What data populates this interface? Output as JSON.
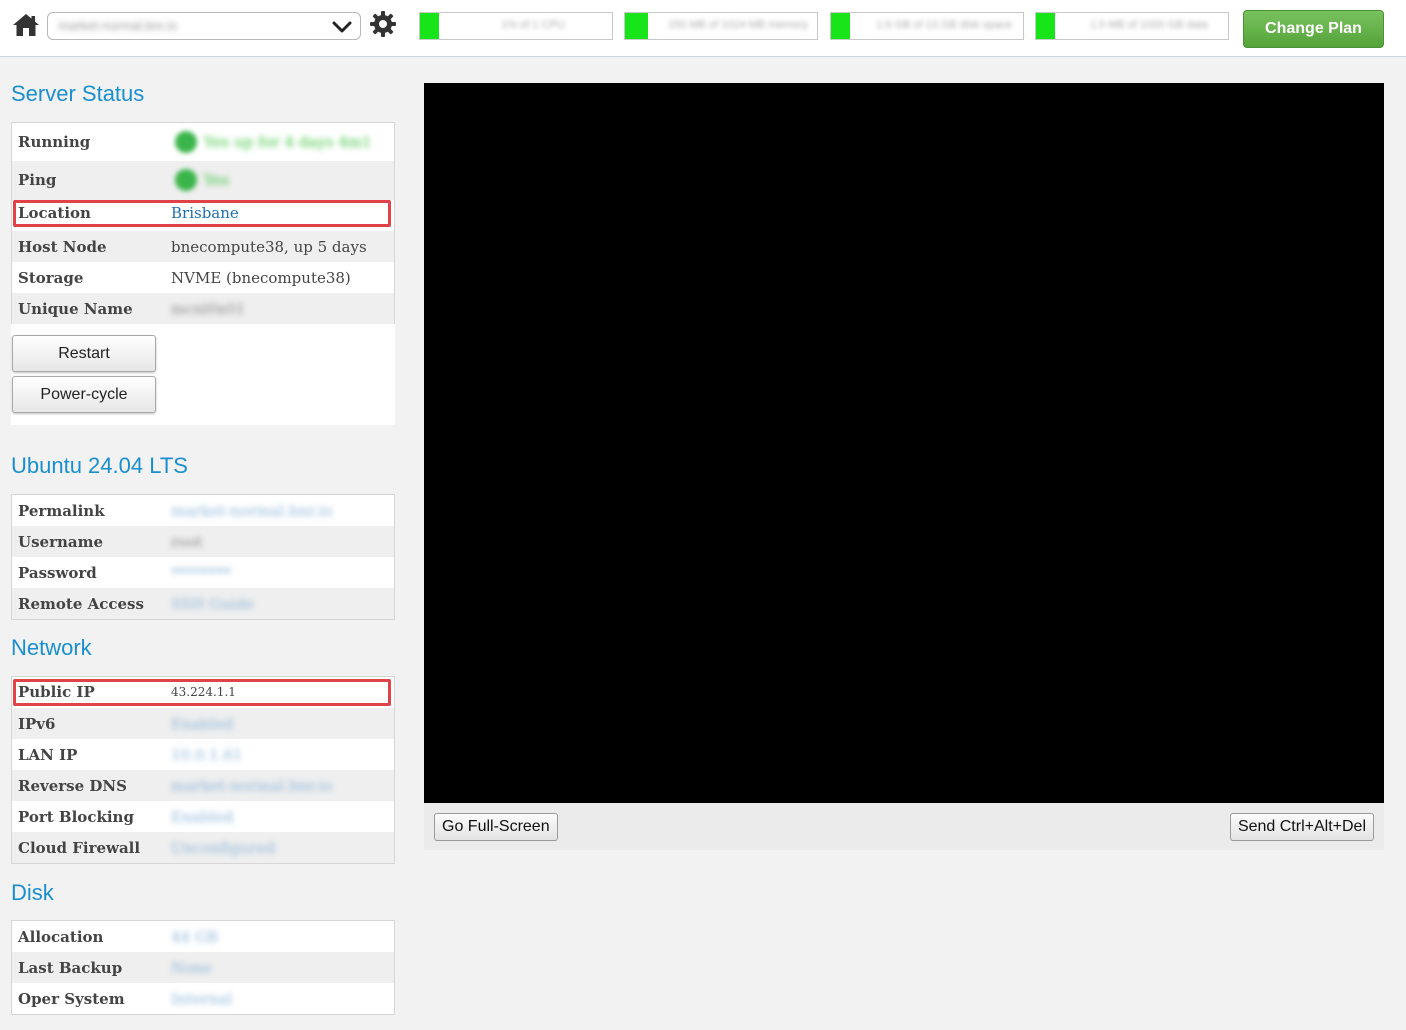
{
  "header": {
    "server_select_value": "market-normal.bnr.io",
    "meters": [
      {
        "label": "1% of 1 CPU",
        "fraction": 0.1
      },
      {
        "label": "150 MB of 1024 MB memory",
        "fraction": 0.12
      },
      {
        "label": "1.6 GB of 13 GB disk space",
        "fraction": 0.1
      },
      {
        "label": "1.5 MB of 1000 GB data",
        "fraction": 0.1
      }
    ],
    "change_plan_label": "Change Plan"
  },
  "server_status": {
    "title": "Server Status",
    "rows": [
      {
        "key": "Running",
        "value": "Yes up for 4 days 4m1"
      },
      {
        "key": "Ping",
        "value": "Yes"
      },
      {
        "key": "Location",
        "value": "Brisbane"
      },
      {
        "key": "Host Node",
        "value": "bnecompute38, up 5 days"
      },
      {
        "key": "Storage",
        "value": "NVME (bnecompute38)"
      },
      {
        "key": "Unique Name",
        "value": "mcnl0x01"
      }
    ],
    "restart_label": "Restart",
    "powercycle_label": "Power-cycle"
  },
  "os": {
    "title": "Ubuntu 24.04 LTS",
    "rows": [
      {
        "key": "Permalink",
        "value": "market-normal.bnr.io"
      },
      {
        "key": "Username",
        "value": "root"
      },
      {
        "key": "Password",
        "value": "********"
      },
      {
        "key": "Remote Access",
        "value": "SSH Guide"
      }
    ]
  },
  "network": {
    "title": "Network",
    "rows": [
      {
        "key": "Public IP",
        "value": "43.224.1.1"
      },
      {
        "key": "IPv6",
        "value": "Enabled"
      },
      {
        "key": "LAN IP",
        "value": "10.0.1.61"
      },
      {
        "key": "Reverse DNS",
        "value": "market-normal.bnr.io"
      },
      {
        "key": "Port Blocking",
        "value": "Enabled"
      },
      {
        "key": "Cloud Firewall",
        "value": "Unconfigured"
      }
    ]
  },
  "disk": {
    "title": "Disk",
    "rows": [
      {
        "key": "Allocation",
        "value": "44 GB"
      },
      {
        "key": "Last Backup",
        "value": "None"
      },
      {
        "key": "Oper System",
        "value": "Internal"
      }
    ]
  },
  "console": {
    "fullscreen_label": "Go Full-Screen",
    "ctrlaltdel_label": "Send Ctrl+Alt+Del"
  },
  "colors": {
    "accent": "#1a8fd0",
    "highlight": "#e0424a",
    "meter_fill": "#18e41a",
    "change_plan": "#5faa44"
  },
  "icons": [
    "home-icon",
    "chevron-down-icon",
    "gear-icon",
    "status-check-icon"
  ]
}
